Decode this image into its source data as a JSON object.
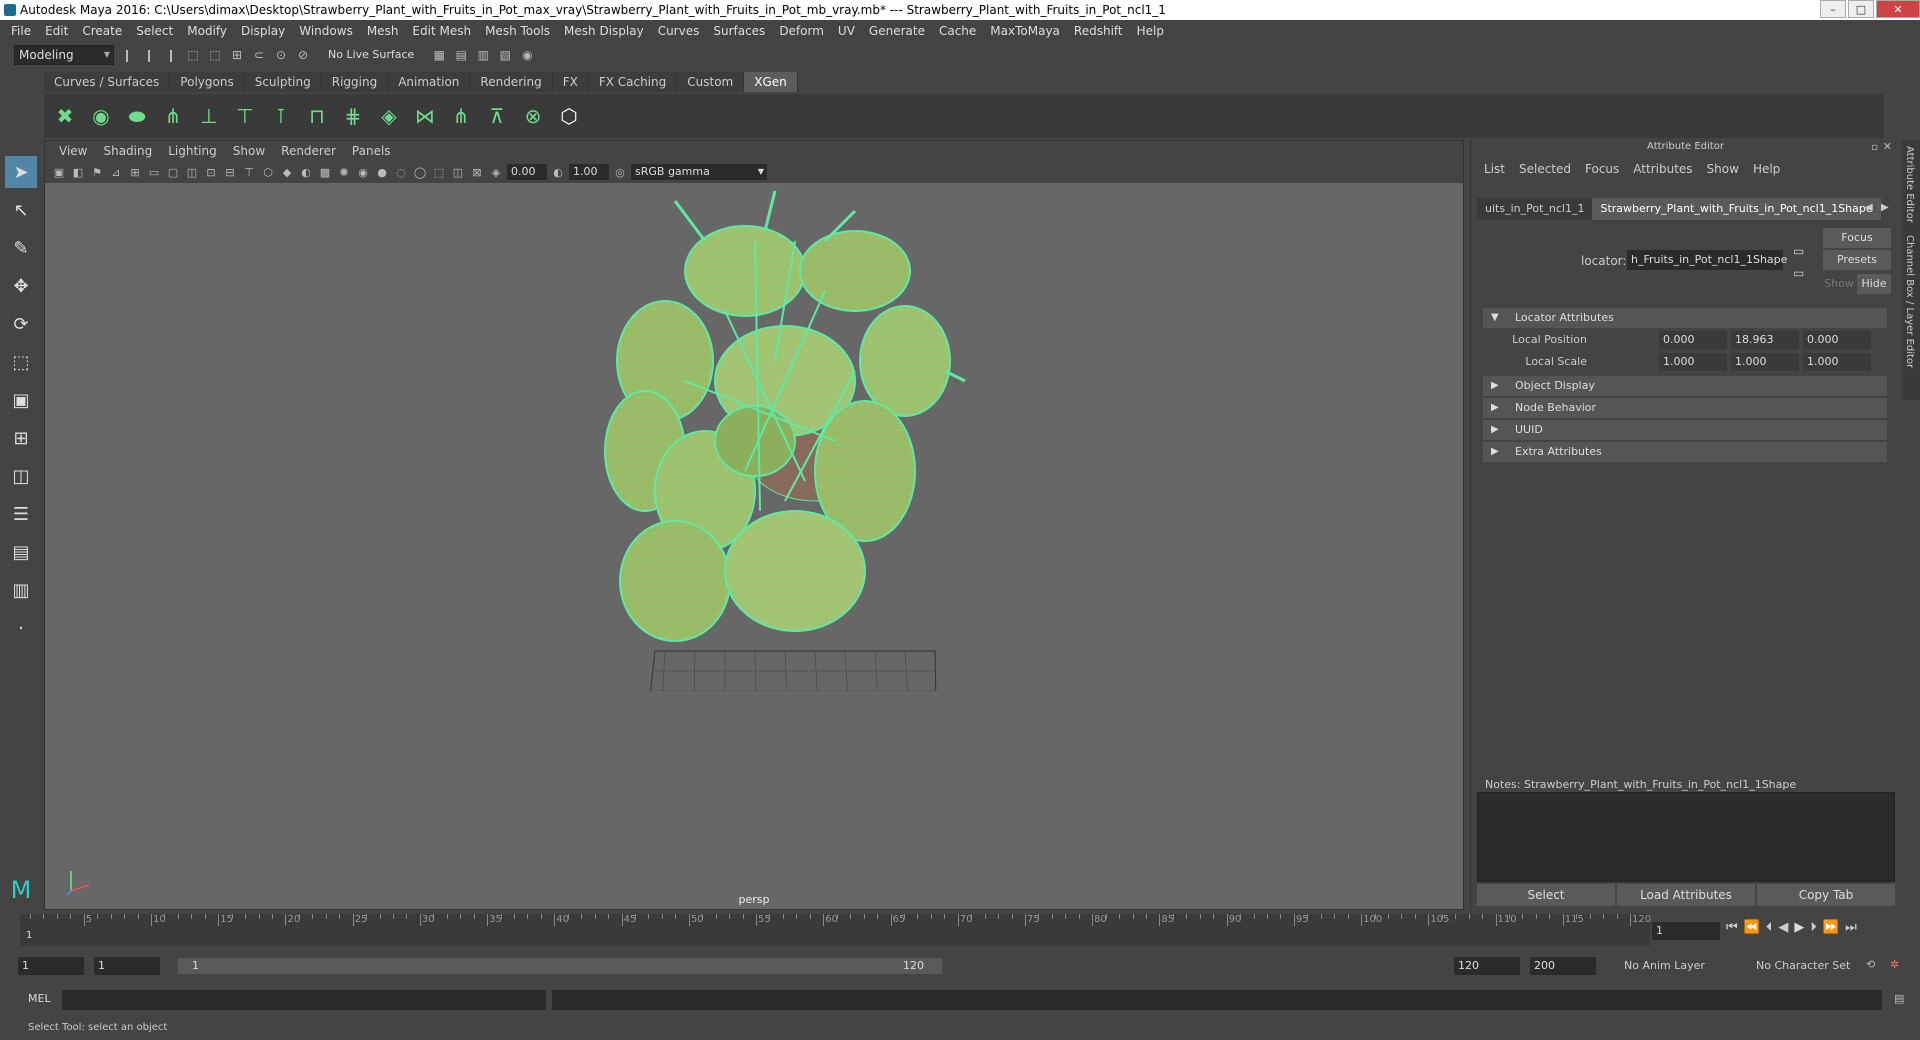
{
  "window": {
    "title": "Autodesk Maya 2016: C:\\Users\\dimax\\Desktop\\Strawberry_Plant_with_Fruits_in_Pot_max_vray\\Strawberry_Plant_with_Fruits_in_Pot_mb_vray.mb*  ---  Strawberry_Plant_with_Fruits_in_Pot_ncl1_1"
  },
  "menu": [
    "File",
    "Edit",
    "Create",
    "Select",
    "Modify",
    "Display",
    "Windows",
    "Mesh",
    "Edit Mesh",
    "Mesh Tools",
    "Mesh Display",
    "Curves",
    "Surfaces",
    "Deform",
    "UV",
    "Generate",
    "Cache",
    "MaxToMaya",
    "Redshift",
    "Help"
  ],
  "status": {
    "mode": "Modeling",
    "live_surface": "No Live Surface"
  },
  "shelf_tabs": [
    "Curves / Surfaces",
    "Polygons",
    "Sculpting",
    "Rigging",
    "Animation",
    "Rendering",
    "FX",
    "FX Caching",
    "Custom",
    "XGen"
  ],
  "shelf_active": "XGen",
  "viewport": {
    "menu": [
      "View",
      "Shading",
      "Lighting",
      "Show",
      "Renderer",
      "Panels"
    ],
    "exposure": "0.00",
    "gamma_value": "1.00",
    "color_space": "sRGB gamma",
    "camera": "persp"
  },
  "attribute_editor": {
    "title": "Attribute Editor",
    "menu": [
      "List",
      "Selected",
      "Focus",
      "Attributes",
      "Show",
      "Help"
    ],
    "tab1": "uits_in_Pot_ncl1_1",
    "tab2": "Strawberry_Plant_with_Fruits_in_Pot_ncl1_1Shape",
    "locator_label": "locator:",
    "locator_value": "h_Fruits_in_Pot_ncl1_1Shape",
    "focus": "Focus",
    "presets": "Presets",
    "show": "Show",
    "hide": "Hide",
    "sections": {
      "locator": "Locator Attributes",
      "object_display": "Object Display",
      "node_behavior": "Node Behavior",
      "uuid": "UUID",
      "extra": "Extra Attributes"
    },
    "local_position": {
      "label": "Local Position",
      "x": "0.000",
      "y": "18.963",
      "z": "0.000"
    },
    "local_scale": {
      "label": "Local Scale",
      "x": "1.000",
      "y": "1.000",
      "z": "1.000"
    },
    "notes": "Notes:  Strawberry_Plant_with_Fruits_in_Pot_ncl1_1Shape",
    "buttons": {
      "select": "Select",
      "load": "Load Attributes",
      "copy": "Copy Tab"
    },
    "side_tabs": [
      "Attribute Editor",
      "Channel Box / Layer Editor"
    ]
  },
  "timeline": {
    "ticks": [
      "5",
      "10",
      "15",
      "20",
      "25",
      "30",
      "35",
      "40",
      "45",
      "50",
      "55",
      "60",
      "65",
      "70",
      "75",
      "80",
      "85",
      "90",
      "95",
      "100",
      "105",
      "110",
      "115",
      "120"
    ],
    "start_label": "1",
    "current_frame": "1"
  },
  "range": {
    "start": "1",
    "playback_start": "1",
    "slider_low": "1",
    "slider_high": "120",
    "playback_end": "120",
    "end": "200",
    "anim_layer": "No Anim Layer",
    "char_set": "No Character Set"
  },
  "mel": {
    "label": "MEL"
  },
  "help_line": "Select Tool: select an object"
}
